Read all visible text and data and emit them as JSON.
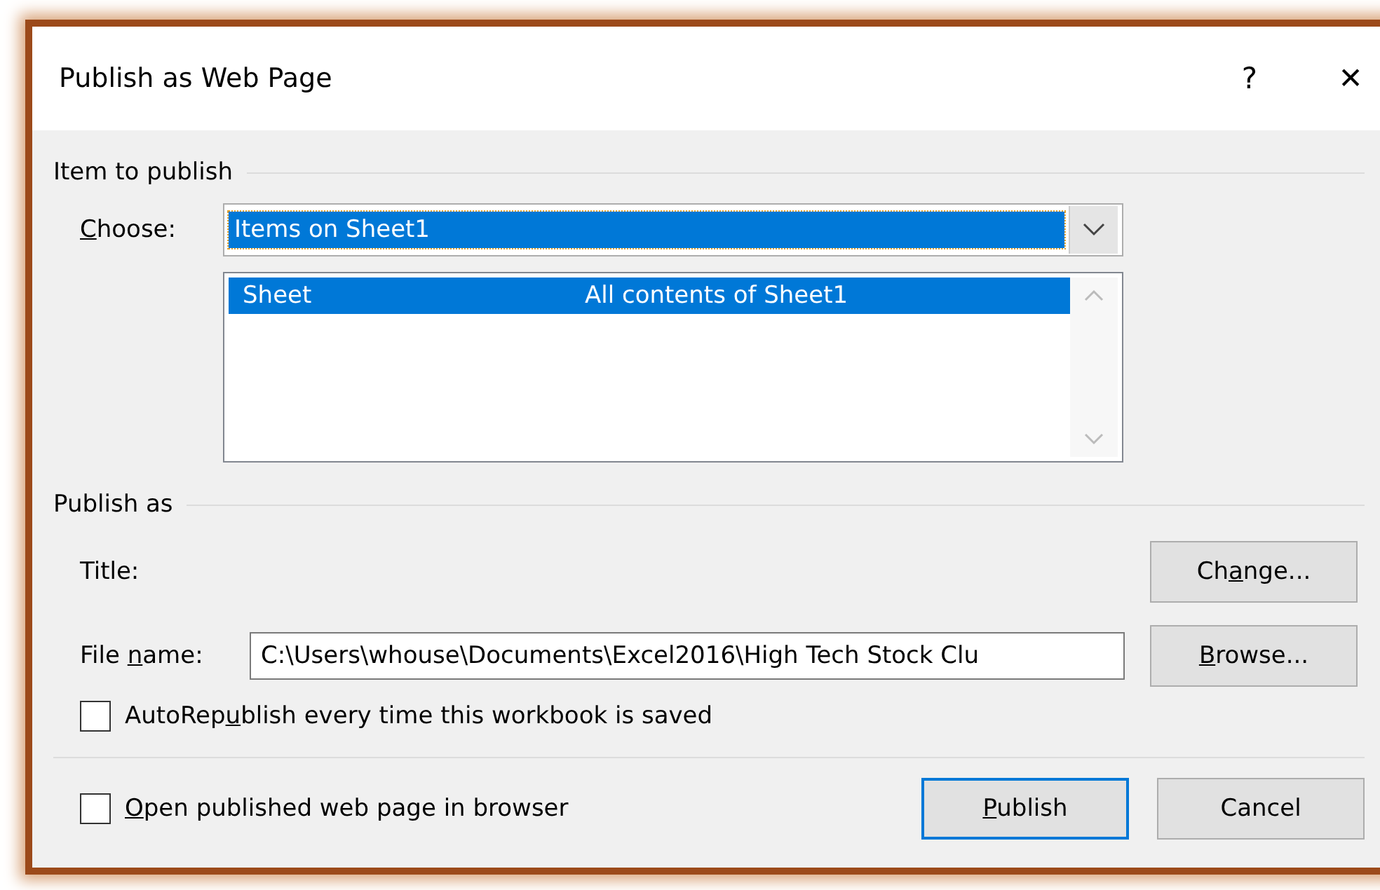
{
  "window": {
    "title": "Publish as Web Page",
    "help": "?",
    "close": "✕"
  },
  "item_section": {
    "heading": "Item to publish",
    "choose_label": {
      "key": "C",
      "post": "hoose:"
    },
    "choose_value": "Items on Sheet1",
    "list_items": [
      {
        "name": "Sheet",
        "description": "All contents of Sheet1",
        "selected": true
      }
    ]
  },
  "publish_section": {
    "heading": "Publish as",
    "title_label": "Title:",
    "change_button": {
      "pre": "Ch",
      "key": "a",
      "post": "nge..."
    },
    "file_label": {
      "pre": "File ",
      "key": "n",
      "post": "ame:"
    },
    "file_value": "C:\\Users\\whouse\\Documents\\Excel2016\\High Tech Stock Clu",
    "browse_button": {
      "key": "B",
      "post": "rowse..."
    },
    "autorepublish": {
      "label": {
        "pre": "AutoRep",
        "key": "u",
        "post": "blish every time this workbook is saved"
      },
      "checked": false
    }
  },
  "open_in_browser": {
    "label": {
      "key": "O",
      "post": "pen published web page in browser"
    },
    "checked": false
  },
  "buttons": [
    {
      "label": {
        "key": "P",
        "post": "ublish"
      },
      "default": true
    },
    {
      "label": {
        "pre": "Cancel"
      },
      "default": false
    }
  ]
}
